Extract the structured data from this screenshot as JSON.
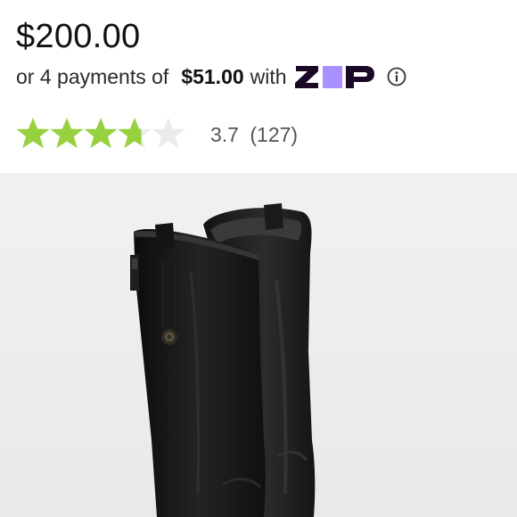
{
  "product": {
    "price": "$200.00",
    "installments": {
      "prefix": "or 4 payments of",
      "amount": "$51.00",
      "connector": "with",
      "provider_logo": "zip-logo",
      "info_icon": "info-icon"
    },
    "rating": {
      "score": "3.7",
      "count": "(127)",
      "max_stars": 5,
      "filled_color": "#97d13f",
      "empty_color": "#ebebeb"
    },
    "image": {
      "subject": "black leather riding boots"
    }
  },
  "colors": {
    "zip_text": "#1a0826",
    "zip_accent": "#aa8fff",
    "image_background": "#efefef"
  }
}
